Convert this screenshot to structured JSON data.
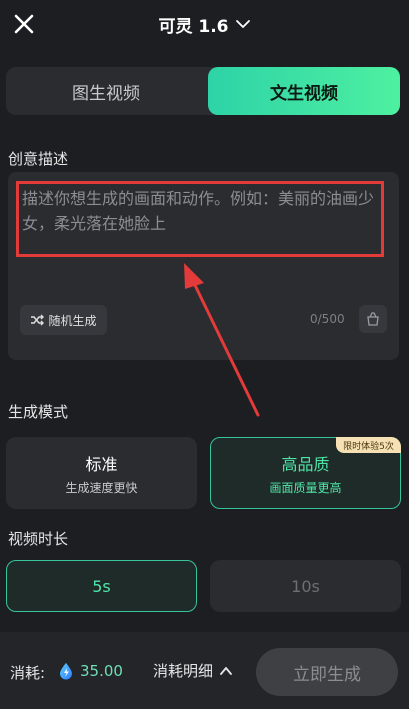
{
  "header": {
    "title": "可灵 1.6",
    "close_icon": "close-icon",
    "dropdown_icon": "chevron-down-icon"
  },
  "tabs": [
    {
      "label": "图生视频",
      "active": false
    },
    {
      "label": "文生视频",
      "active": true
    }
  ],
  "prompt": {
    "section_label": "创意描述",
    "placeholder": "描述你想生成的画面和动作。例如：美丽的油画少女，柔光落在她脸上",
    "random_label": "随机生成",
    "char_count": "0/500"
  },
  "mode": {
    "section_label": "生成模式",
    "options": [
      {
        "title": "标准",
        "subtitle": "生成速度更快",
        "selected": false
      },
      {
        "title": "高品质",
        "subtitle": "画面质量更高",
        "selected": true,
        "badge": "限时体验5次"
      }
    ]
  },
  "duration": {
    "section_label": "视频时长",
    "options": [
      {
        "label": "5s",
        "selected": true
      },
      {
        "label": "10s",
        "selected": false
      }
    ]
  },
  "footer": {
    "cost_label": "消耗:",
    "cost_value": "35.00",
    "detail_label": "消耗明细",
    "generate_label": "立即生成"
  },
  "colors": {
    "accent": "#4ee6a8",
    "highlight_frame": "#e33a3a",
    "background": "#1c1e21"
  }
}
